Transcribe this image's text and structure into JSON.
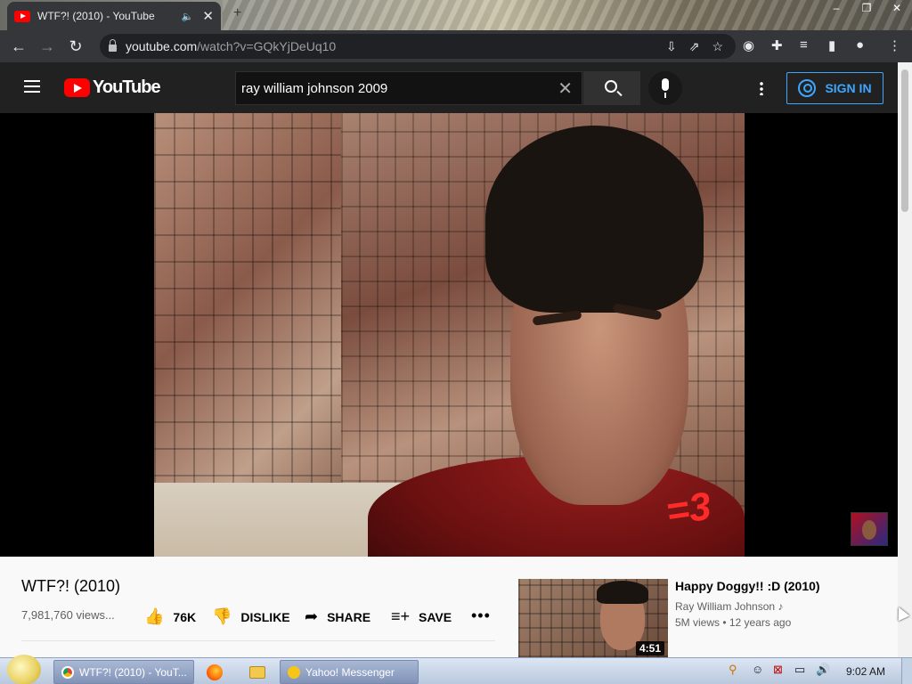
{
  "browser": {
    "tab_title": "WTF?! (2010) - YouTube",
    "url_host": "youtube.com",
    "url_path": "/watch?v=GQkYjDeUq10"
  },
  "header": {
    "logo_text": "YouTube",
    "search_query": "ray william johnson 2009",
    "sign_in_label": "SIGN IN"
  },
  "video": {
    "overlay_text": "=3",
    "title": "WTF?! (2010)",
    "views": "7,981,760 views...",
    "likes": "76K",
    "dislike_label": "DISLIKE",
    "share_label": "SHARE",
    "save_label": "SAVE"
  },
  "related": [
    {
      "title": "Happy Doggy!! :D (2010)",
      "channel": "Ray William Johnson",
      "meta": "5M views • 12 years ago",
      "duration": "4:51"
    }
  ],
  "taskbar": {
    "items": [
      {
        "label": "WTF?! (2010) - YouT..."
      },
      {
        "label": "Yahoo! Messenger"
      }
    ],
    "clock": "9:02 AM"
  },
  "colors": {
    "youtube_red": "#ff0000",
    "sign_in_blue": "#3ea6ff",
    "header_bg": "#212121"
  }
}
